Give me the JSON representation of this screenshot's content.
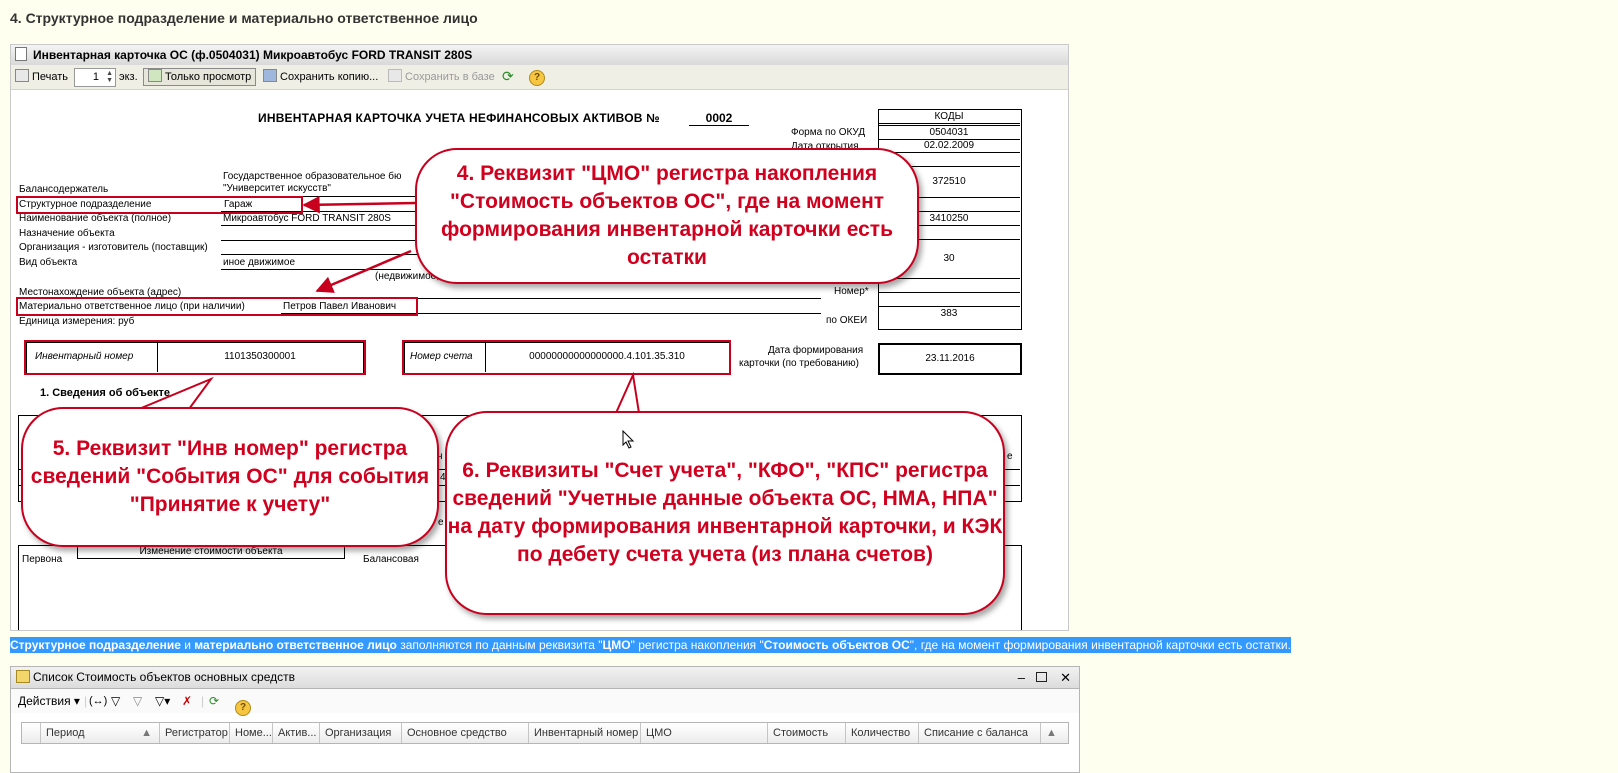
{
  "heading": "4. Структурное подразделение и материально ответственное лицо",
  "window1": {
    "title": "Инвентарная карточка ОС (ф.0504031) Микроавтобус FORD TRANSIT 280S",
    "toolbar": {
      "print": "Печать",
      "copies": "1",
      "copies_unit": "экз.",
      "view_only": "Только просмотр",
      "save_copy": "Сохранить копию...",
      "save_db": "Сохранить в базе",
      "help": "?"
    }
  },
  "form": {
    "title": "ИНВЕНТАРНАЯ КАРТОЧКА УЧЕТА НЕФИНАНСОВЫХ АКТИВОВ  №",
    "number": "0002",
    "codes_header": "КОДЫ",
    "okud_label": "Форма по ОКУД",
    "okud": "0504031",
    "open_date_label": "Дата открытия",
    "open_date": "02.02.2009",
    "code1": "372510",
    "code2": "3410250",
    "code3": "30",
    "number_label": "Номер*",
    "okei_label": "по ОКЕИ",
    "okei": "383",
    "holder_label": "Балансодержатель",
    "holder_line1": "Государственное образовательное бю",
    "holder_line2": "\"Университет искусств\"",
    "unit_label": "Структурное подразделение",
    "unit_value": "Гараж",
    "name_label": "Наименование объекта (полное)",
    "name_value": "Микроавтобус FORD TRANSIT 280S",
    "purpose_label": "Назначение объекта",
    "maker_label": "Организация - изготовитель (поставщик)",
    "kind_label": "Вид объекта",
    "kind_value": "иное движимое",
    "kind_note": "(недвижимое,",
    "location_label": "Местонахождение объекта (адрес)",
    "mol_label": "Материально ответственное лицо (при наличии)",
    "mol_value": "Петров Павел Иванович",
    "unit_measure": "Единица измерения: руб",
    "inv_label": "Инвентарный номер",
    "inv_value": "1101350300001",
    "acc_label": "Номер счета",
    "acc_value": "00000000000000000.4.101.35.310",
    "card_date_label1": "Дата формирования",
    "card_date_label2": "карточки (по требованию)",
    "card_date": "23.11.2016",
    "section1": "1. Сведения об объекте",
    "change_cost": "Изменение стоимости объекта",
    "first_cell": "Первона",
    "balance_cell": "Балансовая",
    "frag_1": "н",
    "frag_2": "4",
    "frag_3": "е",
    "frag_4": "е"
  },
  "callouts": {
    "c4": "4. Реквизит \"ЦМО\" регистра накопления \"Стоимость объектов ОС\", где на момент формирования инвентарной карточки есть остатки",
    "c5": "5. Реквизит \"Инв номер\" регистра сведений \"События ОС\" для события \"Принятие к учету\"",
    "c6": "6. Реквизиты \"Счет учета\", \"КФО\", \"КПС\" регистра сведений \"Учетные данные объекта ОС, НМА, НПА\" на дату формирования инвентарной карточки, и КЭК по дебету счета учета (из плана счетов)"
  },
  "description": {
    "b1": "Структурное подразделение",
    "t1": " и ",
    "b2": "материально ответственное лицо",
    "t2": " заполняются по данным реквизита \"",
    "b3": "ЦМО",
    "t3": "\" регистра накопления \"",
    "b4": "Стоимость объектов ОС",
    "t4": "\", где на момент формирования инвентарной карточки есть остатки."
  },
  "window2": {
    "title": "Список Стоимость объектов основных средств",
    "actions": "Действия",
    "help": "?",
    "columns": [
      "Период",
      "Регистратор",
      "Номе...",
      "Актив...",
      "Организация",
      "Основное средство",
      "Инвентарный номер",
      "ЦМО",
      "Стоимость",
      "Количество",
      "Списание с баланса"
    ]
  }
}
